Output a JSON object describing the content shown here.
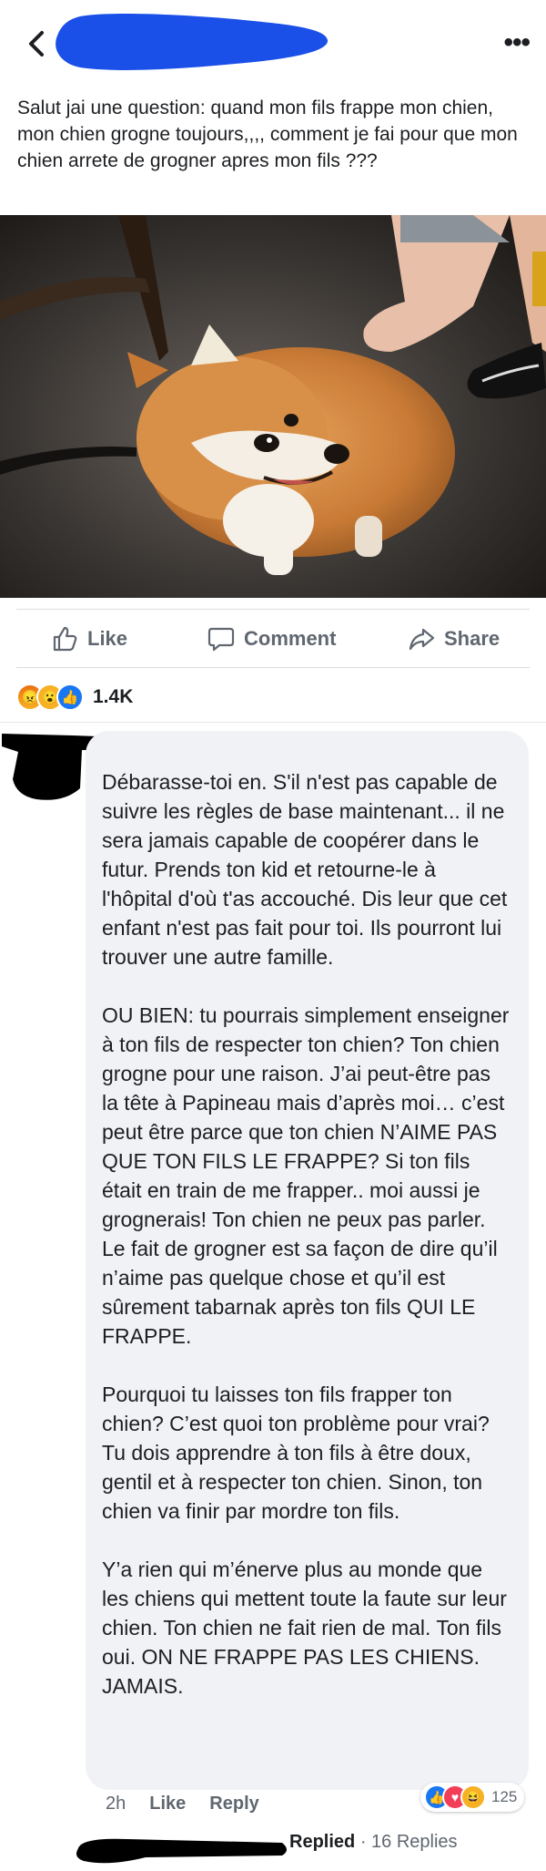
{
  "header": {
    "back_icon": "chevron-left-icon",
    "more_icon": "ellipsis-icon",
    "author_redacted": true
  },
  "post": {
    "text": "Salut jai une question: quand mon fils frappe mon chien, mon chien grogne toujours,,,, comment je fai pour que mon chien arrete de grogner apres mon fils ???"
  },
  "actions": {
    "like": "Like",
    "comment": "Comment",
    "share": "Share"
  },
  "reactions": {
    "icons": [
      "angry",
      "wow",
      "like"
    ],
    "count": "1.4K"
  },
  "comment": {
    "paragraphs": [
      "Débarasse-toi en. S'il n'est pas capable de suivre les règles de base maintenant... il ne sera jamais capable de coopérer dans le futur. Prends ton kid et retourne-le à l'hôpital d'où t'as accouché. Dis leur que cet enfant n'est pas fait pour toi. Ils pourront lui trouver une autre famille.",
      "OU BIEN: tu pourrais simplement enseigner à ton fils de respecter ton chien? Ton chien grogne pour une raison. J’ai peut-être pas la tête à Papineau mais d’après moi… c’est peut être parce que ton chien N’AIME PAS QUE TON FILS LE FRAPPE? Si ton fils était en train de me frapper.. moi aussi je grognerais! Ton chien ne peux pas parler. Le fait de grogner est sa façon de dire qu’il n’aime pas quelque chose et qu’il est sûrement tabarnak après ton fils QUI LE FRAPPE.",
      "Pourquoi tu laisses ton fils frapper ton chien? C’est quoi ton problème pour vrai? Tu dois apprendre à ton fils à être doux, gentil et à respecter ton chien. Sinon, ton chien va finir par mordre ton fils.",
      "Y’a rien qui m’énerve plus au monde que les chiens qui mettent toute la faute sur leur chien. Ton chien ne fait rien de mal. Ton fils oui. ON NE FRAPPE PAS LES CHIENS. JAMAIS."
    ],
    "time": "2h",
    "like": "Like",
    "reply": "Reply",
    "reaction_icons": [
      "like",
      "love",
      "haha"
    ],
    "reaction_count": "125"
  },
  "replies": {
    "replied": "Replied",
    "count_text": "· 16 Replies"
  },
  "colors": {
    "like_blue": "#1877f2",
    "love_red": "#f33e58",
    "reaction_yellow": "#f7b125",
    "redaction_blue": "#1a4fe8",
    "bubble_gray": "#f0f2f5"
  }
}
